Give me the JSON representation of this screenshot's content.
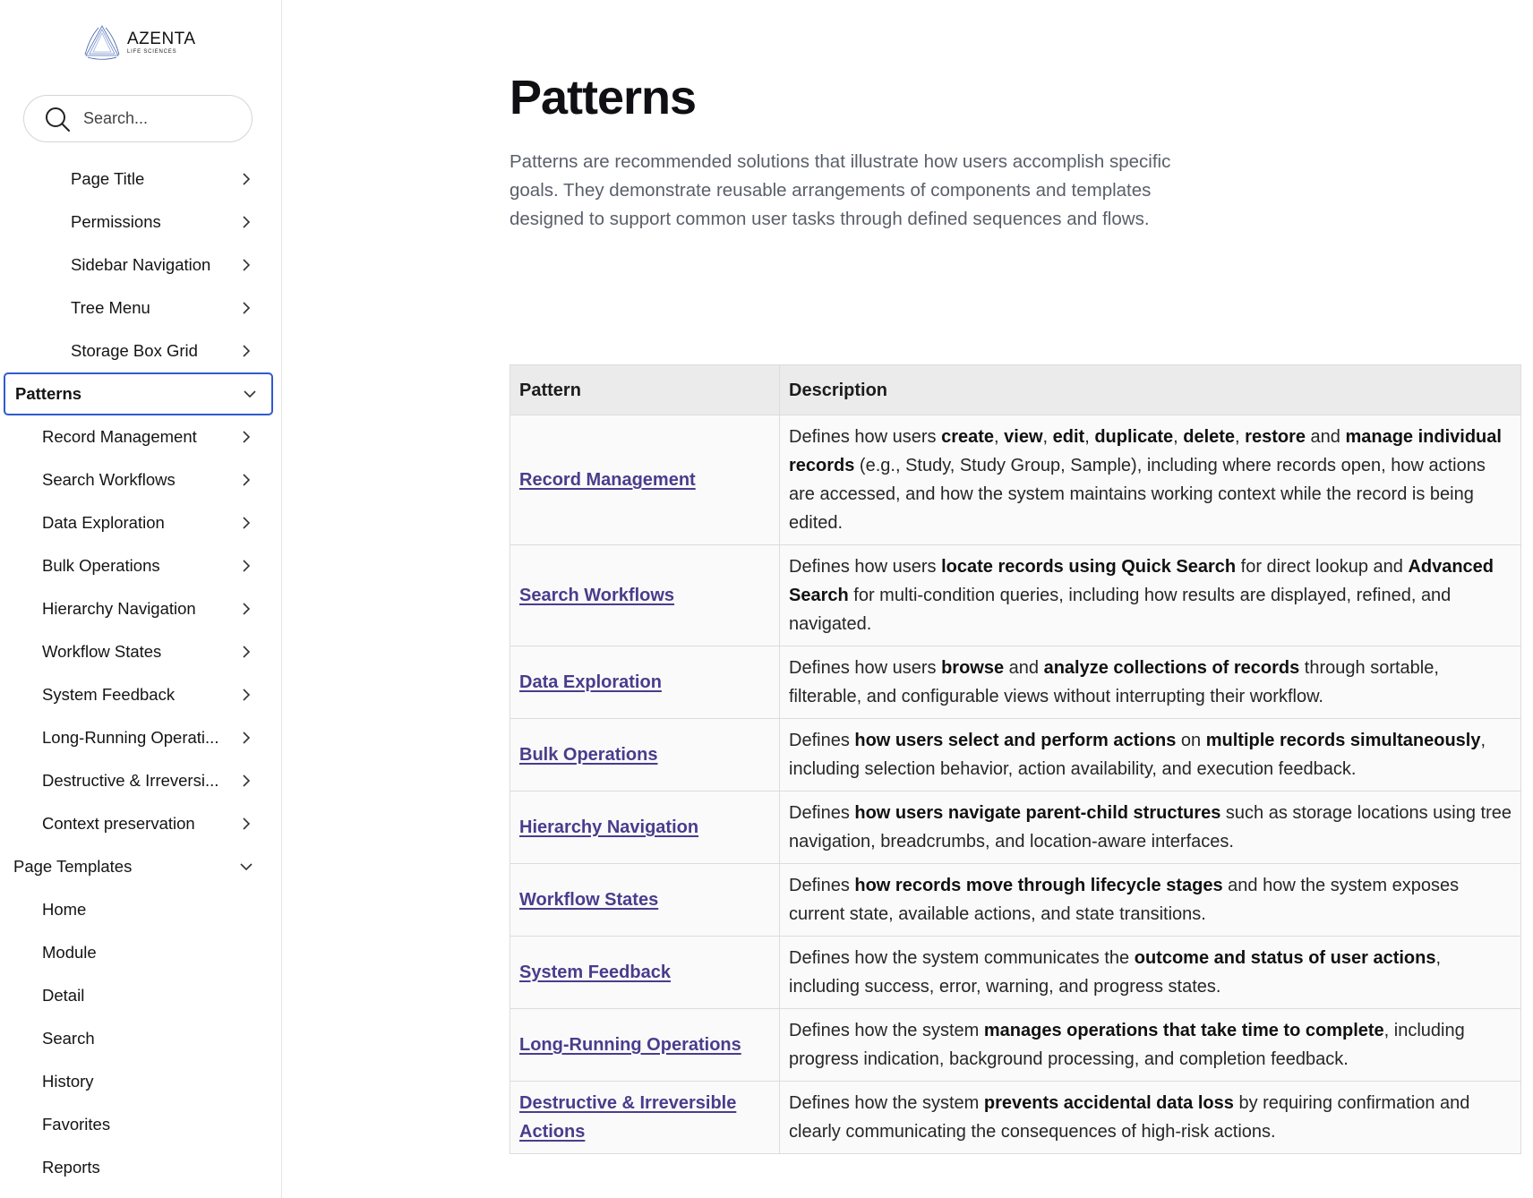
{
  "brand": {
    "name": "AZENTA",
    "sub": "LIFE SCIENCES"
  },
  "search": {
    "placeholder": "Search..."
  },
  "sidebar": {
    "components_tail": [
      "Page Title",
      "Permissions",
      "Sidebar Navigation",
      "Tree Menu",
      "Storage Box Grid"
    ],
    "patterns_label": "Patterns",
    "patterns_items": [
      "Record Management",
      "Search Workflows",
      "Data Exploration",
      "Bulk Operations",
      "Hierarchy Navigation",
      "Workflow States",
      "System Feedback",
      "Long-Running Operati...",
      "Destructive & Irreversi...",
      "Context preservation"
    ],
    "templates_label": "Page Templates",
    "templates_items": [
      "Home",
      "Module",
      "Detail",
      "Search",
      "History",
      "Favorites",
      "Reports"
    ]
  },
  "main": {
    "title": "Patterns",
    "intro": "Patterns are recommended solutions that illustrate how users accomplish specific goals. They demonstrate reusable arrangements of components and templates designed to support common user tasks through defined sequences and flows.",
    "table": {
      "headers": [
        "Pattern",
        "Description"
      ],
      "rows": [
        {
          "name": "Record Management",
          "desc": [
            [
              "Defines how users ",
              0
            ],
            [
              "create",
              1
            ],
            [
              ", ",
              0
            ],
            [
              "view",
              1
            ],
            [
              ", ",
              0
            ],
            [
              "edit",
              1
            ],
            [
              ", ",
              0
            ],
            [
              "duplicate",
              1
            ],
            [
              ", ",
              0
            ],
            [
              "delete",
              1
            ],
            [
              ", ",
              0
            ],
            [
              "restore",
              1
            ],
            [
              " and ",
              0
            ],
            [
              "manage individual records",
              1
            ],
            [
              " (e.g., Study, Study Group, Sample), including where records open, how actions are accessed, and how the system maintains working context while the record is being edited.",
              0
            ]
          ]
        },
        {
          "name": "Search Workflows",
          "desc": [
            [
              "Defines how users ",
              0
            ],
            [
              "locate records using Quick Search",
              1
            ],
            [
              " for direct lookup and ",
              0
            ],
            [
              "Advanced Search",
              1
            ],
            [
              " for multi-condition queries, including how results are displayed, refined, and navigated.",
              0
            ]
          ]
        },
        {
          "name": "Data Exploration",
          "desc": [
            [
              "Defines how users ",
              0
            ],
            [
              "browse",
              1
            ],
            [
              " and ",
              0
            ],
            [
              "analyze collections of records",
              1
            ],
            [
              " through sortable, filterable, and configurable views without interrupting their workflow.",
              0
            ]
          ]
        },
        {
          "name": "Bulk Operations",
          "desc": [
            [
              "Defines ",
              0
            ],
            [
              "how users select and perform actions",
              1
            ],
            [
              " on ",
              0
            ],
            [
              "multiple records simultaneously",
              1
            ],
            [
              ", including selection behavior, action availability, and execution feedback.",
              0
            ]
          ]
        },
        {
          "name": "Hierarchy Navigation",
          "desc": [
            [
              "Defines ",
              0
            ],
            [
              "how users navigate parent-child structures",
              1
            ],
            [
              " such as storage locations using tree navigation, breadcrumbs, and location-aware interfaces.",
              0
            ]
          ]
        },
        {
          "name": "Workflow States",
          "desc": [
            [
              "Defines ",
              0
            ],
            [
              "how records move through lifecycle stages",
              1
            ],
            [
              " and how the system exposes current state, available actions, and state transitions.",
              0
            ]
          ]
        },
        {
          "name": "System Feedback",
          "desc": [
            [
              "Defines how the system communicates the ",
              0
            ],
            [
              "outcome and status of user actions",
              1
            ],
            [
              ", including success, error, warning, and progress states.",
              0
            ]
          ]
        },
        {
          "name": "Long-Running Operations",
          "desc": [
            [
              "Defines how the system ",
              0
            ],
            [
              "manages operations that take time to complete",
              1
            ],
            [
              ", including progress indication, background processing, and completion feedback.",
              0
            ]
          ]
        },
        {
          "name": "Destructive & Irreversible Actions",
          "desc": [
            [
              "Defines how the system ",
              0
            ],
            [
              "prevents accidental data loss",
              1
            ],
            [
              " by requiring confirmation and clearly communicating the consequences of high-risk actions.",
              0
            ]
          ]
        }
      ]
    }
  },
  "colors": {
    "accent": "#2f5bd0",
    "link": "#4a3c8c",
    "header_bg": "#ebebeb"
  },
  "icons": {
    "search": "search-icon",
    "chevron_right": "chevron-right-icon",
    "chevron_down": "chevron-down-icon"
  }
}
